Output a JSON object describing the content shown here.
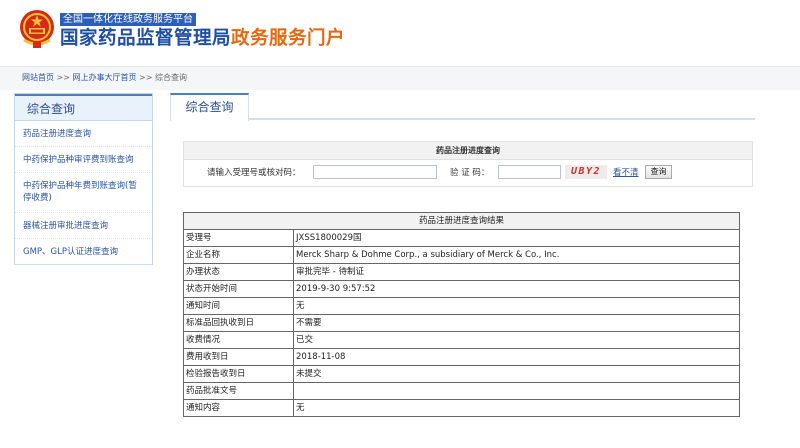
{
  "header": {
    "platform_tag": "全国一体化在线政务服务平台",
    "title_blue": "国家药品监督管理局",
    "title_orange": "政务服务门户"
  },
  "breadcrumb": {
    "home": "网站首页",
    "sep1": " >> ",
    "hall": "网上办事大厅首页",
    "sep2": " >> ",
    "current": "综合查询"
  },
  "sidebar": {
    "title": "综合查询",
    "items": [
      {
        "label": "药品注册进度查询"
      },
      {
        "label": "中药保护品种审评费到账查询"
      },
      {
        "label": "中药保护品种年费到账查询(暂停收费)"
      },
      {
        "label": "器械注册审批进度查询"
      },
      {
        "label": "GMP、GLP认证进度查询"
      }
    ]
  },
  "main": {
    "tab_label": "综合查询"
  },
  "query_form": {
    "title": "药品注册进度查询",
    "id_label": "请输入受理号或核对码：",
    "id_value": "",
    "captcha_label": "验 证 码：",
    "captcha_value": "",
    "captcha_text": "UBY2",
    "refresh_label": "看不清",
    "submit_label": "查询"
  },
  "results": {
    "title": "药品注册进度查询结果",
    "rows": [
      {
        "label": "受理号",
        "value": "JXSS1800029国"
      },
      {
        "label": "企业名称",
        "value": "Merck Sharp & Dohme Corp., a subsidiary of Merck & Co., Inc."
      },
      {
        "label": "办理状态",
        "value": "审批完毕 - 待制证"
      },
      {
        "label": "状态开始时间",
        "value": "2019-9-30 9:57:52"
      },
      {
        "label": "通知时间",
        "value": "无"
      },
      {
        "label": "标准品回执收到日",
        "value": "不需要"
      },
      {
        "label": "收费情况",
        "value": "已交"
      },
      {
        "label": "费用收到日",
        "value": "2018-11-08"
      },
      {
        "label": "检验报告收到日",
        "value": "未提交"
      },
      {
        "label": "药品批准文号",
        "value": ""
      },
      {
        "label": "通知内容",
        "value": "无"
      }
    ]
  },
  "colors": {
    "brand_blue": "#1f4fa5",
    "brand_orange": "#e8670e",
    "link_blue": "#2a55a5"
  }
}
